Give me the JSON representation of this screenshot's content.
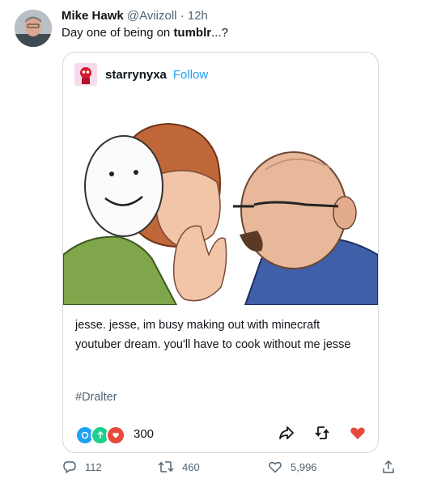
{
  "tweet": {
    "author_name": "Mike Hawk",
    "author_handle": "@Aviizoll",
    "separator": "·",
    "time": "12h",
    "text_pre": "Day one of being on ",
    "text_bold": "tumblr",
    "text_post": "...?"
  },
  "tumblr_post": {
    "username": "starrynyxa",
    "follow_label": "Follow",
    "caption": "jesse. jesse, im busy making out with minecraft youtuber dream. you'll have to cook without me jesse",
    "tag": "#Dralter",
    "notes_count": "300"
  },
  "actions": {
    "replies": "112",
    "retweets": "460",
    "likes": "5,996"
  },
  "colors": {
    "link_blue": "#1da1f2",
    "like_red": "#e64a3b",
    "reblog_green": "#1dd08b",
    "note_blue": "#1da1f2",
    "note_red": "#e64a3b",
    "gray_text": "#536471"
  }
}
